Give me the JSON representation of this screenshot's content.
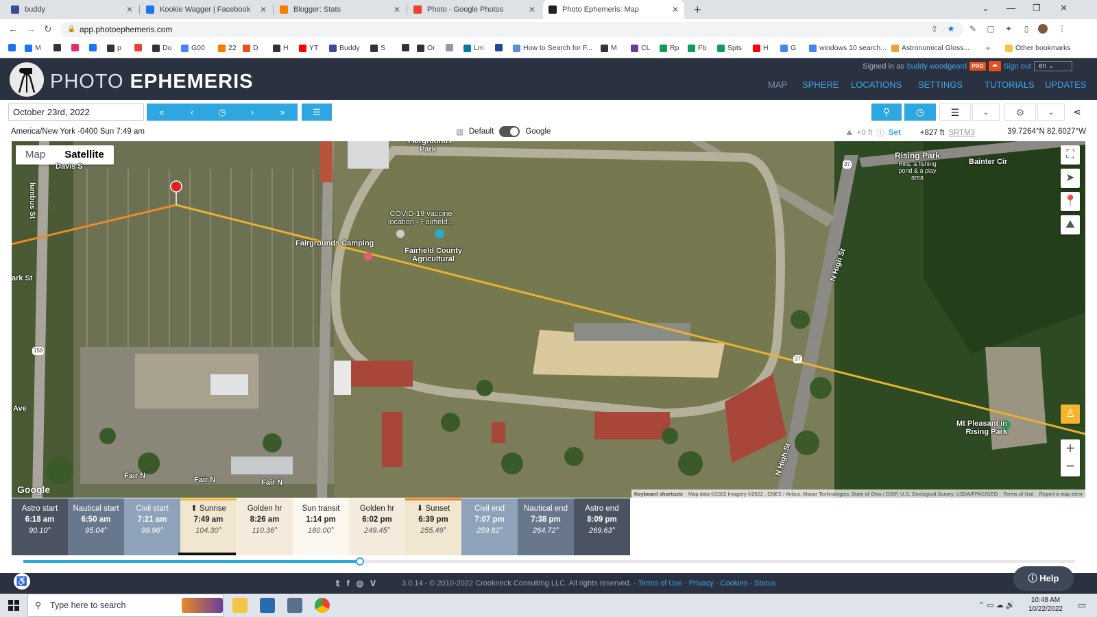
{
  "browser": {
    "tabs": [
      {
        "title": "buddy",
        "color": "#3b4a9c"
      },
      {
        "title": "Kookie Wagger | Facebook",
        "color": "#1877f2"
      },
      {
        "title": "Blogger: Stats",
        "color": "#f57d00"
      },
      {
        "title": "Photo - Google Photos",
        "color": "#ea4335"
      },
      {
        "title": "Photo Ephemeris: Map",
        "color": "#222222"
      }
    ],
    "url": "app.photoephemeris.com",
    "bookmarks": [
      {
        "label": "",
        "color": "#1a73e8"
      },
      {
        "label": "M",
        "color": "#1877f2"
      },
      {
        "label": "",
        "color": "#333333"
      },
      {
        "label": "",
        "color": "#e1306c"
      },
      {
        "label": "",
        "color": "#1877f2"
      },
      {
        "label": "p",
        "color": "#333333"
      },
      {
        "label": "",
        "color": "#ea4335"
      },
      {
        "label": "Do",
        "color": "#333333"
      },
      {
        "label": "G00",
        "color": "#4285f4"
      },
      {
        "label": "22",
        "color": "#f57d00"
      },
      {
        "label": "D",
        "color": "#e8501a"
      },
      {
        "label": "H",
        "color": "#333333"
      },
      {
        "label": "YT",
        "color": "#ff0000"
      },
      {
        "label": "Buddy",
        "color": "#3b4a9c"
      },
      {
        "label": "S",
        "color": "#333333"
      },
      {
        "label": "",
        "color": "#333333"
      },
      {
        "label": "Or",
        "color": "#333333"
      },
      {
        "label": "",
        "color": "#999999"
      },
      {
        "label": "Lm",
        "color": "#0a7a9c"
      },
      {
        "label": "",
        "color": "#1a4a9c"
      },
      {
        "label": "How to Search for F...",
        "color": "#5a8fd8"
      },
      {
        "label": "M",
        "color": "#333333"
      },
      {
        "label": "CL",
        "color": "#6a3d9a"
      },
      {
        "label": "Rp",
        "color": "#0f9d58"
      },
      {
        "label": "Fb",
        "color": "#0f9d58"
      },
      {
        "label": "Spts",
        "color": "#0f9d58"
      },
      {
        "label": "H",
        "color": "#ff0000"
      },
      {
        "label": "G",
        "color": "#4285f4"
      },
      {
        "label": "windows 10 search...",
        "color": "#4285f4"
      },
      {
        "label": "Astronomical Gloss...",
        "color": "#e8a33a"
      }
    ],
    "other_bookmarks": "Other bookmarks"
  },
  "app": {
    "brand_light": "PHOTO",
    "brand_bold": "EPHEMERIS",
    "signed_in_prefix": "Signed in as",
    "user": "buddy woodgeard",
    "pro_badge": "PRO",
    "sign_out": "Sign out",
    "language": "en",
    "nav": [
      "MAP",
      "SPHERE",
      "LOCATIONS",
      "SETTINGS",
      "TUTORIALS",
      "UPDATES"
    ]
  },
  "toolbar": {
    "date": "October 23rd, 2022"
  },
  "status": {
    "timezone": "America/New York -0400 Sun 7:49 am",
    "layer_default": "Default",
    "layer_google": "Google",
    "elev_offset": "+0 ft",
    "set_label": "Set",
    "elevation": "+827 ft",
    "source": "SRTM3",
    "coordinates": "39.7264°N 82.6027°W"
  },
  "map": {
    "map_label": "Map",
    "satellite_label": "Satellite",
    "labels": {
      "davis": "Davis S",
      "columbus": "lumbus St",
      "fairgrounds_park": "Fairgrounds Park",
      "camping": "Fairgrounds Camping",
      "covid": "COVID-19 vaccine location - Fairfield...",
      "fairfield": "Fairfield County Agricultural",
      "rising_park": "Rising Park",
      "rising_park_sub": "Hills, a fishing pond & a play area",
      "bainter": "Bainter Cir",
      "route37a": "37",
      "route37b": "37",
      "route158": "158",
      "park_st": "ark St",
      "ave": "Ave",
      "fair_n1": "Fair N",
      "fair_n2": "Fair N",
      "fair_n3": "Fair N",
      "n_high1": "N High St",
      "n_high2": "N High St",
      "mt_pleasant": "Mt Pleasant in Rising Park",
      "google": "Google"
    },
    "attribution": {
      "shortcuts": "Keyboard shortcuts",
      "data": "Map data ©2022 Imagery ©2022 , CNES / Airbus, Maxar Technologies, State of Ohio / OSIP, U.S. Geological Survey, USDA/FPAC/GEO",
      "terms": "Terms of Use",
      "report": "Report a map error"
    }
  },
  "events": [
    {
      "name": "Astro start",
      "time": "6:18 am",
      "azimuth": "90.10°",
      "style": "dark"
    },
    {
      "name": "Nautical start",
      "time": "6:50 am",
      "azimuth": "95.04°",
      "style": "mid"
    },
    {
      "name": "Civil start",
      "time": "7:21 am",
      "azimuth": "99.96°",
      "style": "light"
    },
    {
      "name": "⬆ Sunrise",
      "time": "7:49 am",
      "azimuth": "104.30°",
      "style": "rise"
    },
    {
      "name": "Golden hr",
      "time": "8:26 am",
      "azimuth": "110.36°",
      "style": "gold"
    },
    {
      "name": "Sun transit",
      "time": "1:14 pm",
      "azimuth": "180.00°",
      "style": "noon"
    },
    {
      "name": "Golden hr",
      "time": "6:02 pm",
      "azimuth": "249.45°",
      "style": "gold"
    },
    {
      "name": "⬇ Sunset",
      "time": "6:39 pm",
      "azimuth": "255.49°",
      "style": "set"
    },
    {
      "name": "Civil end",
      "time": "7:07 pm",
      "azimuth": "259.82°",
      "style": "light"
    },
    {
      "name": "Nautical end",
      "time": "7:38 pm",
      "azimuth": "264.72°",
      "style": "mid"
    },
    {
      "name": "Astro end",
      "time": "8:09 pm",
      "azimuth": "269.63°",
      "style": "dark"
    }
  ],
  "time_slider_fraction": 0.32,
  "footer": {
    "copyright": "3.0.14 - © 2010-2022 Crookneck Consulting LLC. All rights reserved. ·",
    "terms": "Terms of Use",
    "privacy": "Privacy",
    "cookies": "Cookies",
    "status": "Status",
    "help": "Help"
  },
  "taskbar": {
    "search_placeholder": "Type here to search",
    "time": "10:48 AM",
    "date": "10/22/2022"
  }
}
